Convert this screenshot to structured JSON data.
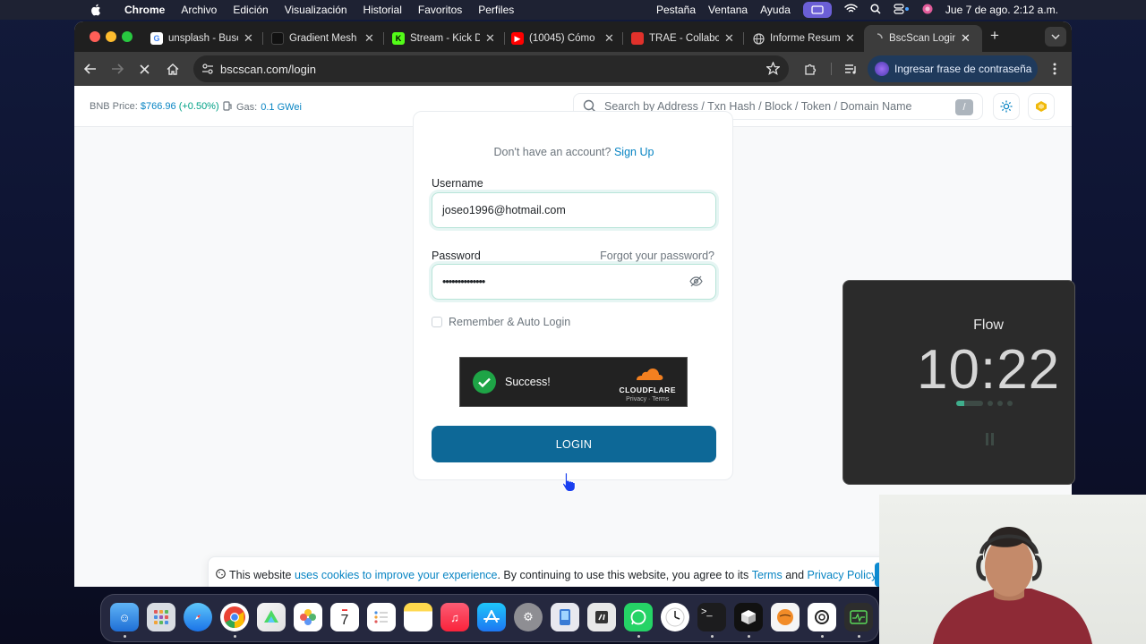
{
  "menubar": {
    "app": "Chrome",
    "items": [
      "Archivo",
      "Edición",
      "Visualización",
      "Historial",
      "Favoritos",
      "Perfiles"
    ],
    "right_items": [
      "Pestaña",
      "Ventana",
      "Ayuda"
    ],
    "clock": "Jue 7 de ago.  2:12 a.m."
  },
  "tabs": [
    {
      "label": "unsplash - Busc",
      "icon": "google-icon"
    },
    {
      "label": "Gradient Mesh",
      "icon": "gradient-icon"
    },
    {
      "label": "Stream - Kick D",
      "icon": "kick-icon"
    },
    {
      "label": "(10045) Cómo",
      "icon": "youtube-icon"
    },
    {
      "label": "TRAE - Collabo",
      "icon": "trae-icon"
    },
    {
      "label": "Informe Resum",
      "icon": "globe-icon"
    },
    {
      "label": "BscScan Login",
      "icon": "bscscan-icon",
      "active": true
    }
  ],
  "toolbar": {
    "url": "bscscan.com/login",
    "password_chip": "Ingresar frase de contraseña"
  },
  "site": {
    "bnb_label": "BNB Price:",
    "bnb_price": "$766.96",
    "bnb_change": "(+0.50%)",
    "gas_label": "Gas:",
    "gas_value": "0.1 GWei",
    "search_placeholder": "Search by Address / Txn Hash / Block / Token / Domain Name",
    "search_shortcut": "/"
  },
  "login": {
    "no_account": "Don't have an account?",
    "signup": "Sign Up",
    "username_label": "Username",
    "username_value": "joseo1996@hotmail.com",
    "password_label": "Password",
    "forgot": "Forgot your password?",
    "password_value": "••••••••••••••",
    "remember": "Remember & Auto Login",
    "captcha_status": "Success!",
    "captcha_brand": "CLOUDFLARE",
    "captcha_links": "Privacy  ·  Terms",
    "login_button": "LOGIN"
  },
  "cookie": {
    "part1": "This website",
    "link1": "uses cookies to improve your experience",
    "part2": ". By continuing to use this website, you agree to its",
    "terms": "Terms",
    "and": "and",
    "privacy": "Privacy Policy",
    "period": "."
  },
  "flow": {
    "title": "Flow",
    "time": "10:22"
  },
  "dock": {
    "calendar_day": "7"
  },
  "colors": {
    "accent": "#0784c3",
    "login_button": "#0d6897",
    "positive": "#00a186",
    "success": "#1ea446"
  }
}
